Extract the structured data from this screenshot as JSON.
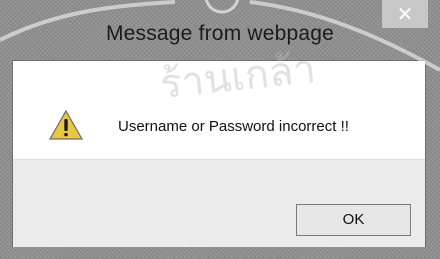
{
  "window": {
    "title": "Message from webpage",
    "close_glyph": "✕"
  },
  "dialog": {
    "icon": "warning-icon",
    "message": "Username or Password incorrect !!",
    "ok_label": "OK"
  },
  "watermark": {
    "text": "ร้านเกล้า"
  },
  "colors": {
    "chrome": "#8f8f8f",
    "client": "#ffffff",
    "footer": "#ebebeb",
    "warning_yellow": "#e8c840"
  }
}
